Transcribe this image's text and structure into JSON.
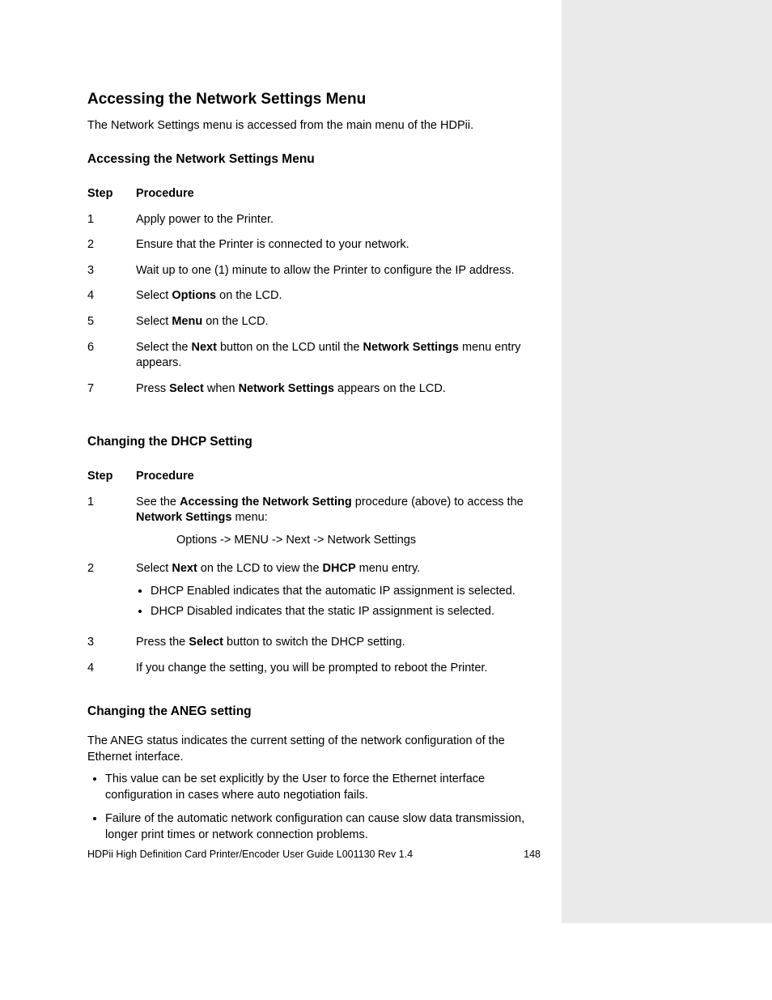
{
  "headings": {
    "main": "Accessing the Network Settings Menu",
    "sub1": "Accessing the Network Settings Menu",
    "sub2": "Changing the DHCP Setting",
    "aneg": "Changing the ANEG setting"
  },
  "intro": "The Network Settings menu is accessed from the main menu of the HDPii.",
  "table1": {
    "head_step": "Step",
    "head_proc": "Procedure",
    "rows": {
      "n1": "1",
      "p1": "Apply power to the Printer.",
      "n2": "2",
      "p2": "Ensure that the Printer is connected to your network.",
      "n3": "3",
      "p3": "Wait up to one (1) minute to allow the Printer to configure the IP address.",
      "n4": "4",
      "p4a": "Select ",
      "p4b": "Options",
      "p4c": " on the LCD.",
      "n5": "5",
      "p5a": "Select ",
      "p5b": "Menu",
      "p5c": " on the LCD.",
      "n6": "6",
      "p6a": "Select the ",
      "p6b": "Next",
      "p6c": " button on the LCD until the ",
      "p6d": "Network Settings",
      "p6e": " menu entry appears.",
      "n7": "7",
      "p7a": "Press ",
      "p7b": "Select",
      "p7c": " when ",
      "p7d": "Network Settings",
      "p7e": " appears on the LCD."
    }
  },
  "table2": {
    "head_step": "Step",
    "head_proc": "Procedure",
    "rows": {
      "n1": "1",
      "p1a": "See the ",
      "p1b": "Accessing the Network Setting",
      "p1c": " procedure (above) to access the ",
      "p1d": "Network Settings",
      "p1e": " menu:",
      "p1path": "Options -> MENU -> Next -> Network Settings",
      "n2": "2",
      "p2a": "Select ",
      "p2b": "Next",
      "p2c": " on the LCD to view the ",
      "p2d": "DHCP",
      "p2e": " menu entry.",
      "p2li1": "DHCP Enabled indicates that the automatic IP assignment is selected.",
      "p2li2": "DHCP Disabled indicates that the static IP assignment is selected.",
      "n3": "3",
      "p3a": "Press the ",
      "p3b": "Select",
      "p3c": " button to switch the DHCP setting.",
      "n4": "4",
      "p4": "If you change the setting, you will be prompted to reboot the Printer."
    }
  },
  "aneg": {
    "p1": "The ANEG status indicates the current setting of the network configuration of the Ethernet interface.",
    "li1": "This value can be set explicitly by the User to force the Ethernet interface configuration in cases where auto negotiation fails.",
    "li2": "Failure of the automatic network configuration can cause slow data transmission, longer print times or network connection problems."
  },
  "footer": {
    "left": "HDPii High Definition Card Printer/Encoder User Guide    L001130 Rev 1.4",
    "right": "148"
  }
}
